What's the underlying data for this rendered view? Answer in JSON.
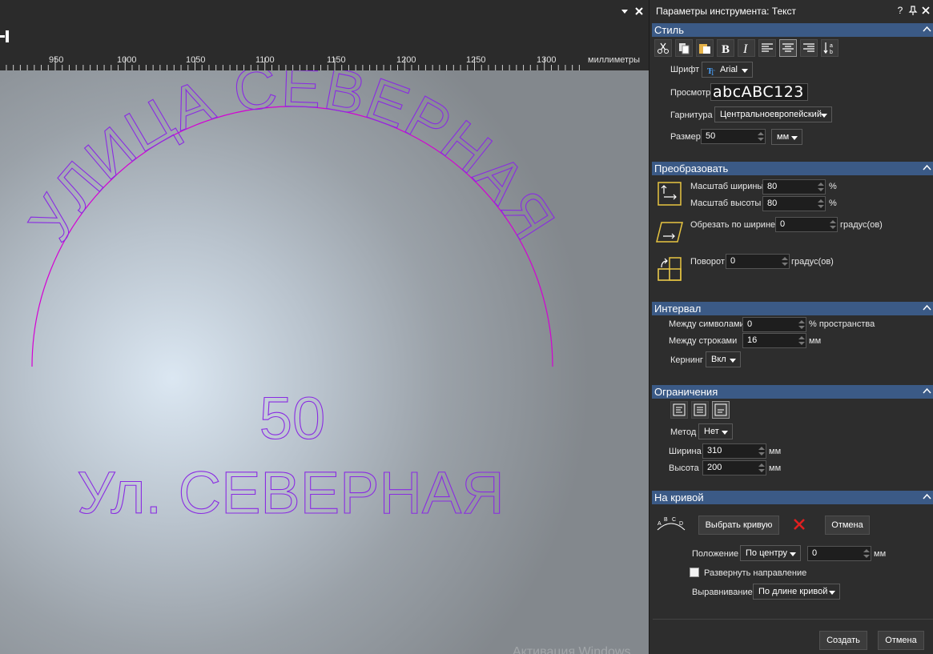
{
  "window_controls": {
    "dropdown_icon": "chevron-down-icon",
    "close_icon": "close-icon"
  },
  "ruler": {
    "labels": [
      "950",
      "1000",
      "1050",
      "1100",
      "1150",
      "1200",
      "1250",
      "1300"
    ],
    "unit": "миллиметры"
  },
  "canvas": {
    "arc_text": "УЛИЦА СЕВЕРНАЯ",
    "number_text": "50",
    "street_text": "Ул. СЕВЕРНАЯ",
    "text_color": "#8a2be2",
    "curve_color": "#d400d4",
    "watermark": "Активация Windows"
  },
  "panel": {
    "title": "Параметры инструмента: Текст",
    "help_label": "?",
    "pin_icon": "pin-icon",
    "close_icon": "close-icon",
    "style": {
      "header": "Стиль",
      "toolbar_icons": [
        "scissors-icon",
        "copy-icon",
        "paste-icon",
        "bold-icon",
        "italic-icon",
        "align-left-icon",
        "align-center-icon",
        "align-right-icon",
        "sort-text-icon"
      ],
      "font_label": "Шрифт",
      "font_value": "Arial",
      "preview_label": "Просмотр",
      "preview_text": "abcABC123",
      "charset_label": "Гарнитура",
      "charset_value": "Центральноевропейский",
      "size_label": "Размер",
      "size_value": "50",
      "size_unit": "мм"
    },
    "transform": {
      "header": "Преобразовать",
      "width_scale_label": "Масштаб ширины",
      "width_scale_value": "80",
      "height_scale_label": "Масштаб высоты",
      "height_scale_value": "80",
      "percent": "%",
      "shear_label": "Обрезать по ширине",
      "shear_value": "0",
      "shear_unit": "градус(ов)",
      "rotate_label": "Поворот",
      "rotate_value": "0",
      "rotate_unit": "градус(ов)"
    },
    "spacing": {
      "header": "Интервал",
      "char_label": "Между символами",
      "char_value": "0",
      "char_unit": "% пространства",
      "line_label": "Между строками",
      "line_value": "16",
      "line_unit": "мм",
      "kerning_label": "Кернинг",
      "kerning_value": "Вкл"
    },
    "limits": {
      "header": "Ограничения",
      "method_label": "Метод",
      "method_value": "Нет",
      "width_label": "Ширина",
      "width_value": "310",
      "width_unit": "мм",
      "height_label": "Высота",
      "height_value": "200",
      "height_unit": "мм"
    },
    "on_curve": {
      "header": "На кривой",
      "select_curve_button": "Выбрать кривую",
      "cancel_button": "Отмена",
      "position_label": "Положение",
      "position_value": "По центру",
      "offset_value": "0",
      "offset_unit": "мм",
      "reverse_label": "Развернуть направление",
      "align_label": "Выравнивание",
      "align_value": "По длине кривой"
    },
    "footer": {
      "create_button": "Создать",
      "cancel_button": "Отмена"
    }
  }
}
